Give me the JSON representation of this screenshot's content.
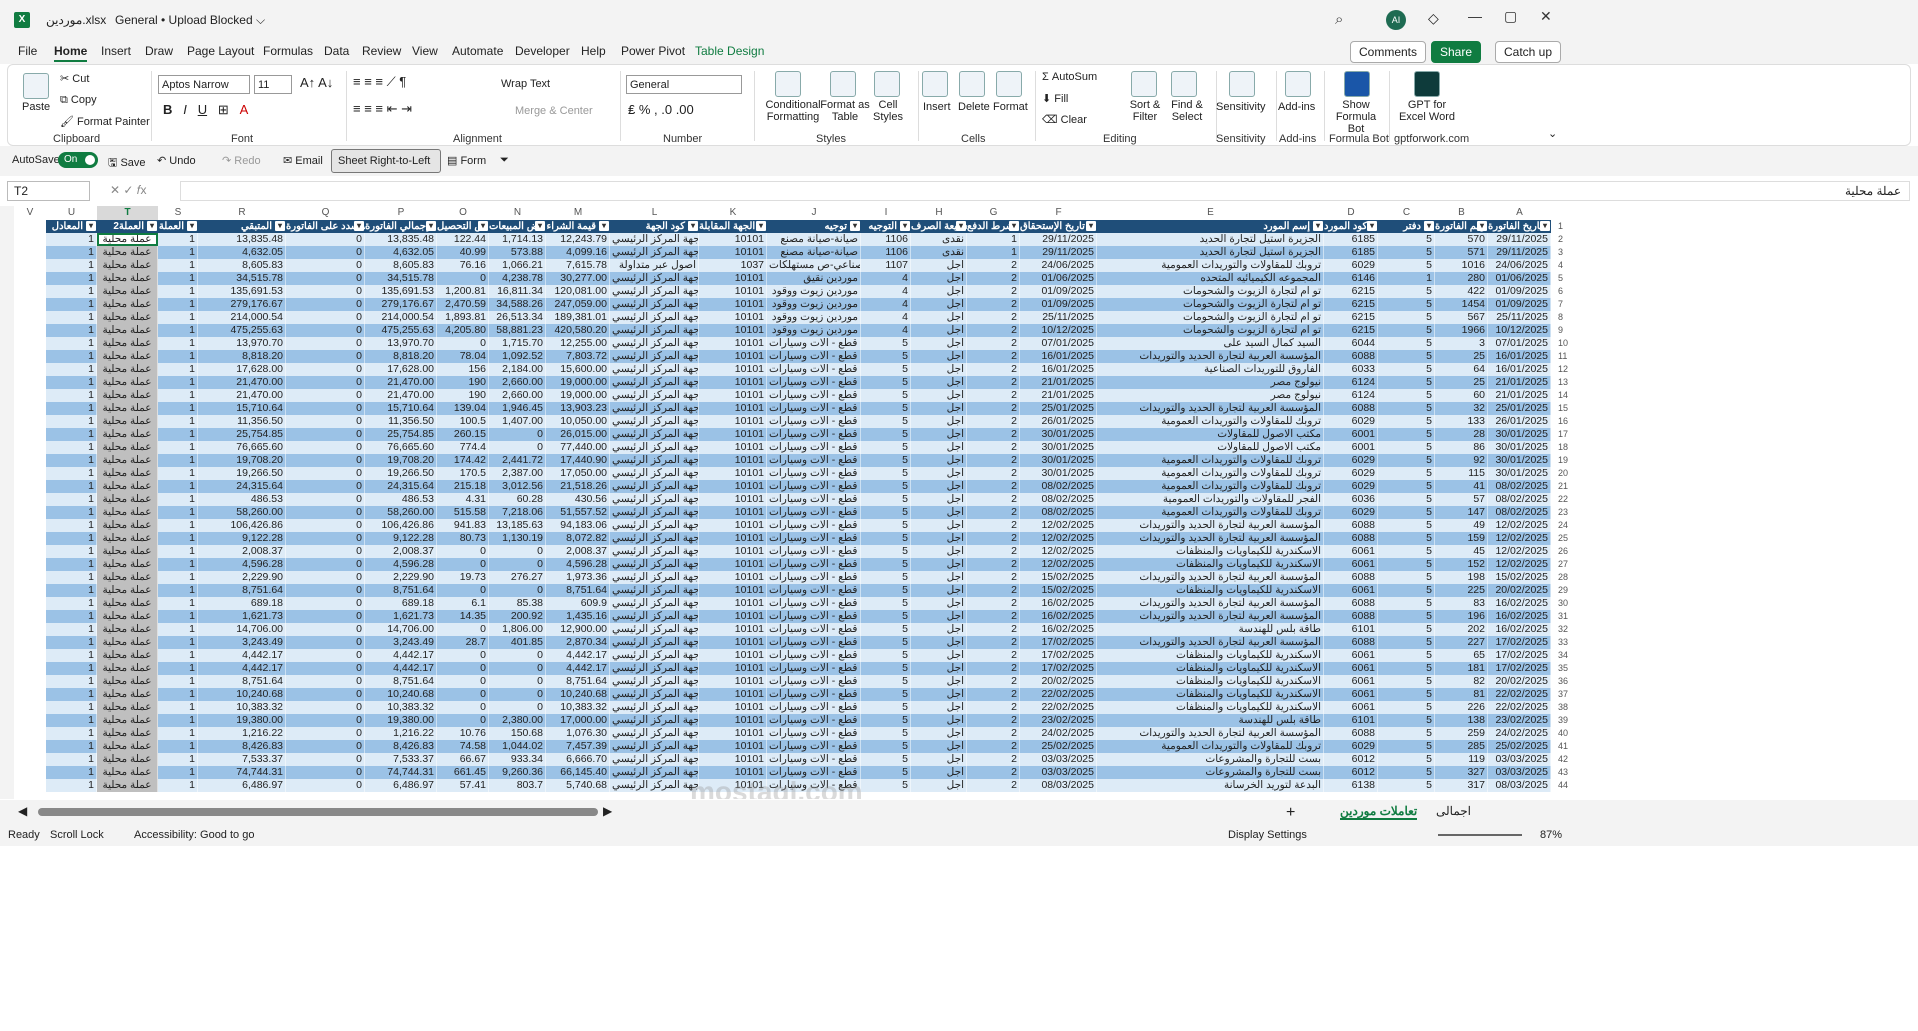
{
  "titlebar": {
    "file": "موردين.xlsx",
    "general": "General • Upload Blocked ⌵",
    "avatar": "AI",
    "minimize": "—",
    "maximize": "▢",
    "close": "✕"
  },
  "tabs": [
    "File",
    "Home",
    "Insert",
    "Draw",
    "Page Layout",
    "Formulas",
    "Data",
    "Review",
    "View",
    "Automate",
    "Developer",
    "Help",
    "Power Pivot",
    "Table Design"
  ],
  "header_btns": {
    "comments": "Comments",
    "share": "Share",
    "catchup": "Catch up"
  },
  "ribbon": {
    "clipboard": {
      "paste": "Paste",
      "cut": "Cut",
      "copy": "Copy",
      "format_painter": "Format Painter",
      "cap": "Clipboard"
    },
    "font": {
      "name": "Aptos Narrow",
      "size": "11",
      "cap": "Font"
    },
    "alignment": {
      "wrap": "Wrap Text",
      "merge": "Merge & Center",
      "cap": "Alignment"
    },
    "number": {
      "format": "General",
      "cap": "Number"
    },
    "styles": {
      "cond": "Conditional Formatting",
      "format_table": "Format as Table",
      "cell_styles": "Cell Styles",
      "cap": "Styles"
    },
    "cells": {
      "insert": "Insert",
      "delete": "Delete",
      "format": "Format",
      "cap": "Cells"
    },
    "editing": {
      "autosum": "AutoSum",
      "fill": "Fill",
      "clear": "Clear",
      "sort": "Sort & Filter",
      "find": "Find & Select",
      "cap": "Editing"
    },
    "sensitivity": {
      "label": "Sensitivity",
      "cap": "Sensitivity"
    },
    "addins": {
      "label": "Add-ins",
      "cap": "Add-ins"
    },
    "formulabot": {
      "label": "Show Formula Bot",
      "cap": "Formula Bot"
    },
    "gpt": {
      "label": "GPT for Excel Word",
      "cap": "gptforwork.com"
    }
  },
  "qat": {
    "autosave": "AutoSave",
    "on": "On",
    "save": "Save",
    "undo": "Undo",
    "redo": "Redo",
    "email": "Email",
    "srtl": "Sheet Right-to-Left",
    "form": "Form"
  },
  "namebox": "T2",
  "formula": "عملة محلية",
  "col_letters": [
    "A",
    "B",
    "C",
    "D",
    "E",
    "F",
    "G",
    "H",
    "I",
    "J",
    "K",
    "L",
    "M",
    "N",
    "O",
    "P",
    "Q",
    "R",
    "S",
    "T",
    "U",
    "V"
  ],
  "headers": [
    "تاريخ الفاتورة",
    "رقم الفاتورة",
    "دفتر",
    "كود المورد",
    "إسم المورد",
    "تاريخ الإستحقاق",
    "شرط الدفع",
    "طبيعة الصرف",
    "التوجيه",
    "توجيه",
    "الجهة المقابلة",
    "كود الجهة",
    "قيمة الشراء",
    "ض المبيعات",
    "ض التحصيل",
    "إجمالي الفاتورة",
    "المسدد على الفاتورة",
    "المتبقي",
    "العملة",
    "العملة2",
    "المعادل"
  ],
  "rows": [
    [
      "29/11/2025",
      "570",
      "5",
      "6185",
      "الجزيرة استيل لتجارة الحديد",
      "29/11/2025",
      "1",
      "نقدى",
      "1106",
      "صيانة-صيانة مصنع",
      "10101",
      "ك جهة المركز الرئيسي",
      "12,243.79",
      "1,714.13",
      "122.44",
      "13,835.48",
      "0",
      "13,835.48",
      "1",
      "عملة محلية",
      "1"
    ],
    [
      "29/11/2025",
      "571",
      "5",
      "6185",
      "الجزيرة استيل لتجارة الحديد",
      "29/11/2025",
      "1",
      "نقدى",
      "1106",
      "صيانة-صيانة مصنع",
      "10101",
      "ك جهة المركز الرئيسي",
      "4,099.16",
      "573.88",
      "40.99",
      "4,632.05",
      "0",
      "4,632.05",
      "1",
      "عملة محلية",
      "1"
    ],
    [
      "24/06/2025",
      "1016",
      "5",
      "6029",
      "تروبك للمقاولات والتوريدات العمومية",
      "24/06/2025",
      "2",
      "اجل",
      "1107",
      "امن صناعي-ص مستهلكات",
      "1037",
      "اصول عبر متداولة",
      "7,615.78",
      "1,066.21",
      "76.16",
      "8,605.83",
      "0",
      "8,605.83",
      "1",
      "عملة محلية",
      "1"
    ],
    [
      "01/06/2025",
      "280",
      "1",
      "6146",
      "المجموعه الكيميائيه المتحده",
      "01/06/2025",
      "2",
      "اجل",
      "4",
      "موردين نقيق",
      "10101",
      "ك جهة المركز الرئيسي",
      "30,277.00",
      "4,238.78",
      "0",
      "34,515.78",
      "0",
      "34,515.78",
      "1",
      "عملة محلية",
      "1"
    ],
    [
      "01/09/2025",
      "422",
      "5",
      "6215",
      "تو ام لتجارة الزيوت والشحومات",
      "01/09/2025",
      "2",
      "اجل",
      "4",
      "موردين زيوت ووقود",
      "10101",
      "ك جهة المركز الرئيسي",
      "120,081.00",
      "16,811.34",
      "1,200.81",
      "135,691.53",
      "0",
      "135,691.53",
      "1",
      "عملة محلية",
      "1"
    ],
    [
      "01/09/2025",
      "1454",
      "5",
      "6215",
      "تو ام لتجارة الزيوت والشحومات",
      "01/09/2025",
      "2",
      "اجل",
      "4",
      "موردين زيوت ووقود",
      "10101",
      "ك جهة المركز الرئيسي",
      "247,059.00",
      "34,588.26",
      "2,470.59",
      "279,176.67",
      "0",
      "279,176.67",
      "1",
      "عملة محلية",
      "1"
    ],
    [
      "25/11/2025",
      "567",
      "5",
      "6215",
      "تو ام لتجارة الزيوت والشحومات",
      "25/11/2025",
      "2",
      "اجل",
      "4",
      "موردين زيوت ووقود",
      "10101",
      "ك جهة المركز الرئيسي",
      "189,381.01",
      "26,513.34",
      "1,893.81",
      "214,000.54",
      "0",
      "214,000.54",
      "1",
      "عملة محلية",
      "1"
    ],
    [
      "10/12/2025",
      "1966",
      "5",
      "6215",
      "تو ام لتجارة الزيوت والشحومات",
      "10/12/2025",
      "2",
      "اجل",
      "4",
      "موردين زيوت ووقود",
      "10101",
      "ك جهة المركز الرئيسي",
      "420,580.20",
      "58,881.23",
      "4,205.80",
      "475,255.63",
      "0",
      "475,255.63",
      "1",
      "عملة محلية",
      "1"
    ],
    [
      "07/01/2025",
      "3",
      "5",
      "6044",
      "السيد كمال السيد على",
      "07/01/2025",
      "2",
      "اجل",
      "5",
      "م قطع - الات وسيارات",
      "10101",
      "ك جهة المركز الرئيسي",
      "12,255.00",
      "1,715.70",
      "0",
      "13,970.70",
      "0",
      "13,970.70",
      "1",
      "عملة محلية",
      "1"
    ],
    [
      "16/01/2025",
      "25",
      "5",
      "6088",
      "المؤسسة العربية لتجارة الحديد والتوريدات",
      "16/01/2025",
      "2",
      "اجل",
      "5",
      "م قطع - الات وسيارات",
      "10101",
      "ك جهة المركز الرئيسي",
      "7,803.72",
      "1,092.52",
      "78.04",
      "8,818.20",
      "0",
      "8,818.20",
      "1",
      "عملة محلية",
      "1"
    ],
    [
      "16/01/2025",
      "64",
      "5",
      "6033",
      "الفاروق للتوريدات الصناعية",
      "16/01/2025",
      "2",
      "اجل",
      "5",
      "م قطع - الات وسيارات",
      "10101",
      "ك جهة المركز الرئيسي",
      "15,600.00",
      "2,184.00",
      "156",
      "17,628.00",
      "0",
      "17,628.00",
      "1",
      "عملة محلية",
      "1"
    ],
    [
      "21/01/2025",
      "25",
      "5",
      "6124",
      "نيولوج مصر",
      "21/01/2025",
      "2",
      "اجل",
      "5",
      "م قطع - الات وسيارات",
      "10101",
      "ك جهة المركز الرئيسي",
      "19,000.00",
      "2,660.00",
      "190",
      "21,470.00",
      "0",
      "21,470.00",
      "1",
      "عملة محلية",
      "1"
    ],
    [
      "21/01/2025",
      "60",
      "5",
      "6124",
      "نيولوج مصر",
      "21/01/2025",
      "2",
      "اجل",
      "5",
      "م قطع - الات وسيارات",
      "10101",
      "ك جهة المركز الرئيسي",
      "19,000.00",
      "2,660.00",
      "190",
      "21,470.00",
      "0",
      "21,470.00",
      "1",
      "عملة محلية",
      "1"
    ],
    [
      "25/01/2025",
      "32",
      "5",
      "6088",
      "المؤسسة العربية لتجارة الحديد والتوريدات",
      "25/01/2025",
      "2",
      "اجل",
      "5",
      "م قطع - الات وسيارات",
      "10101",
      "ك جهة المركز الرئيسي",
      "13,903.23",
      "1,946.45",
      "139.04",
      "15,710.64",
      "0",
      "15,710.64",
      "1",
      "عملة محلية",
      "1"
    ],
    [
      "26/01/2025",
      "133",
      "5",
      "6029",
      "تروبك للمقاولات والتوريدات العمومية",
      "26/01/2025",
      "2",
      "اجل",
      "5",
      "م قطع - الات وسيارات",
      "10101",
      "ك جهة المركز الرئيسي",
      "10,050.00",
      "1,407.00",
      "100.5",
      "11,356.50",
      "0",
      "11,356.50",
      "1",
      "عملة محلية",
      "1"
    ],
    [
      "30/01/2025",
      "28",
      "5",
      "6001",
      "مكتب الاصول للمقاولات",
      "30/01/2025",
      "2",
      "اجل",
      "5",
      "م قطع - الات وسيارات",
      "10101",
      "ك جهة المركز الرئيسي",
      "26,015.00",
      "0",
      "260.15",
      "25,754.85",
      "0",
      "25,754.85",
      "1",
      "عملة محلية",
      "1"
    ],
    [
      "30/01/2025",
      "86",
      "5",
      "6001",
      "مكتب الاصول للمقاولات",
      "30/01/2025",
      "2",
      "اجل",
      "5",
      "م قطع - الات وسيارات",
      "10101",
      "ك جهة المركز الرئيسي",
      "77,440.00",
      "0",
      "774.4",
      "76,665.60",
      "0",
      "76,665.60",
      "1",
      "عملة محلية",
      "1"
    ],
    [
      "30/01/2025",
      "92",
      "5",
      "6029",
      "تروبك للمقاولات والتوريدات العمومية",
      "30/01/2025",
      "2",
      "اجل",
      "5",
      "م قطع - الات وسيارات",
      "10101",
      "ك جهة المركز الرئيسي",
      "17,440.90",
      "2,441.72",
      "174.42",
      "19,708.20",
      "0",
      "19,708.20",
      "1",
      "عملة محلية",
      "1"
    ],
    [
      "30/01/2025",
      "115",
      "5",
      "6029",
      "تروبك للمقاولات والتوريدات العمومية",
      "30/01/2025",
      "2",
      "اجل",
      "5",
      "م قطع - الات وسيارات",
      "10101",
      "ك جهة المركز الرئيسي",
      "17,050.00",
      "2,387.00",
      "170.5",
      "19,266.50",
      "0",
      "19,266.50",
      "1",
      "عملة محلية",
      "1"
    ],
    [
      "08/02/2025",
      "41",
      "5",
      "6029",
      "تروبك للمقاولات والتوريدات العمومية",
      "08/02/2025",
      "2",
      "اجل",
      "5",
      "م قطع - الات وسيارات",
      "10101",
      "ك جهة المركز الرئيسي",
      "21,518.26",
      "3,012.56",
      "215.18",
      "24,315.64",
      "0",
      "24,315.64",
      "1",
      "عملة محلية",
      "1"
    ],
    [
      "08/02/2025",
      "57",
      "5",
      "6036",
      "الفجر للمقاولات والتوريدات العمومية",
      "08/02/2025",
      "2",
      "اجل",
      "5",
      "م قطع - الات وسيارات",
      "10101",
      "ك جهة المركز الرئيسي",
      "430.56",
      "60.28",
      "4.31",
      "486.53",
      "0",
      "486.53",
      "1",
      "عملة محلية",
      "1"
    ],
    [
      "08/02/2025",
      "147",
      "5",
      "6029",
      "تروبك للمقاولات والتوريدات العمومية",
      "08/02/2025",
      "2",
      "اجل",
      "5",
      "م قطع - الات وسيارات",
      "10101",
      "ك جهة المركز الرئيسي",
      "51,557.52",
      "7,218.06",
      "515.58",
      "58,260.00",
      "0",
      "58,260.00",
      "1",
      "عملة محلية",
      "1"
    ],
    [
      "12/02/2025",
      "49",
      "5",
      "6088",
      "المؤسسة العربية لتجارة الحديد والتوريدات",
      "12/02/2025",
      "2",
      "اجل",
      "5",
      "م قطع - الات وسيارات",
      "10101",
      "ك جهة المركز الرئيسي",
      "94,183.06",
      "13,185.63",
      "941.83",
      "106,426.86",
      "0",
      "106,426.86",
      "1",
      "عملة محلية",
      "1"
    ],
    [
      "12/02/2025",
      "159",
      "5",
      "6088",
      "المؤسسة العربية لتجارة الحديد والتوريدات",
      "12/02/2025",
      "2",
      "اجل",
      "5",
      "م قطع - الات وسيارات",
      "10101",
      "ك جهة المركز الرئيسي",
      "8,072.82",
      "1,130.19",
      "80.73",
      "9,122.28",
      "0",
      "9,122.28",
      "1",
      "عملة محلية",
      "1"
    ],
    [
      "12/02/2025",
      "45",
      "5",
      "6061",
      "الاسكندرية للكيماويات والمنظفات",
      "12/02/2025",
      "2",
      "اجل",
      "5",
      "م قطع - الات وسيارات",
      "10101",
      "ك جهة المركز الرئيسي",
      "2,008.37",
      "0",
      "0",
      "2,008.37",
      "0",
      "2,008.37",
      "1",
      "عملة محلية",
      "1"
    ],
    [
      "12/02/2025",
      "152",
      "5",
      "6061",
      "الاسكندرية للكيماويات والمنظفات",
      "12/02/2025",
      "2",
      "اجل",
      "5",
      "م قطع - الات وسيارات",
      "10101",
      "ك جهة المركز الرئيسي",
      "4,596.28",
      "0",
      "0",
      "4,596.28",
      "0",
      "4,596.28",
      "1",
      "عملة محلية",
      "1"
    ],
    [
      "15/02/2025",
      "198",
      "5",
      "6088",
      "المؤسسة العربية لتجارة الحديد والتوريدات",
      "15/02/2025",
      "2",
      "اجل",
      "5",
      "م قطع - الات وسيارات",
      "10101",
      "ك جهة المركز الرئيسي",
      "1,973.36",
      "276.27",
      "19.73",
      "2,229.90",
      "0",
      "2,229.90",
      "1",
      "عملة محلية",
      "1"
    ],
    [
      "20/02/2025",
      "225",
      "5",
      "6061",
      "الاسكندرية للكيماويات والمنظفات",
      "15/02/2025",
      "2",
      "اجل",
      "5",
      "م قطع - الات وسيارات",
      "10101",
      "ك جهة المركز الرئيسي",
      "8,751.64",
      "0",
      "0",
      "8,751.64",
      "0",
      "8,751.64",
      "1",
      "عملة محلية",
      "1"
    ],
    [
      "16/02/2025",
      "83",
      "5",
      "6088",
      "المؤسسة العربية لتجارة الحديد والتوريدات",
      "16/02/2025",
      "2",
      "اجل",
      "5",
      "م قطع - الات وسيارات",
      "10101",
      "ك جهة المركز الرئيسي",
      "609.9",
      "85.38",
      "6.1",
      "689.18",
      "0",
      "689.18",
      "1",
      "عملة محلية",
      "1"
    ],
    [
      "16/02/2025",
      "196",
      "5",
      "6088",
      "المؤسسة العربية لتجارة الحديد والتوريدات",
      "16/02/2025",
      "2",
      "اجل",
      "5",
      "م قطع - الات وسيارات",
      "10101",
      "ك جهة المركز الرئيسي",
      "1,435.16",
      "200.92",
      "14.35",
      "1,621.73",
      "0",
      "1,621.73",
      "1",
      "عملة محلية",
      "1"
    ],
    [
      "16/02/2025",
      "202",
      "5",
      "6101",
      "طاقة بلس للهندسة",
      "16/02/2025",
      "2",
      "اجل",
      "5",
      "م قطع - الات وسيارات",
      "10101",
      "ك جهة المركز الرئيسي",
      "12,900.00",
      "1,806.00",
      "0",
      "14,706.00",
      "0",
      "14,706.00",
      "1",
      "عملة محلية",
      "1"
    ],
    [
      "17/02/2025",
      "227",
      "5",
      "6088",
      "المؤسسة العربية لتجارة الحديد والتوريدات",
      "17/02/2025",
      "2",
      "اجل",
      "5",
      "م قطع - الات وسيارات",
      "10101",
      "ك جهة المركز الرئيسي",
      "2,870.34",
      "401.85",
      "28.7",
      "3,243.49",
      "0",
      "3,243.49",
      "1",
      "عملة محلية",
      "1"
    ],
    [
      "17/02/2025",
      "65",
      "5",
      "6061",
      "الاسكندرية للكيماويات والمنظفات",
      "17/02/2025",
      "2",
      "اجل",
      "5",
      "م قطع - الات وسيارات",
      "10101",
      "ك جهة المركز الرئيسي",
      "4,442.17",
      "0",
      "0",
      "4,442.17",
      "0",
      "4,442.17",
      "1",
      "عملة محلية",
      "1"
    ],
    [
      "17/02/2025",
      "181",
      "5",
      "6061",
      "الاسكندرية للكيماويات والمنظفات",
      "17/02/2025",
      "2",
      "اجل",
      "5",
      "م قطع - الات وسيارات",
      "10101",
      "ك جهة المركز الرئيسي",
      "4,442.17",
      "0",
      "0",
      "4,442.17",
      "0",
      "4,442.17",
      "1",
      "عملة محلية",
      "1"
    ],
    [
      "20/02/2025",
      "82",
      "5",
      "6061",
      "الاسكندرية للكيماويات والمنظفات",
      "20/02/2025",
      "2",
      "اجل",
      "5",
      "م قطع - الات وسيارات",
      "10101",
      "ك جهة المركز الرئيسي",
      "8,751.64",
      "0",
      "0",
      "8,751.64",
      "0",
      "8,751.64",
      "1",
      "عملة محلية",
      "1"
    ],
    [
      "22/02/2025",
      "81",
      "5",
      "6061",
      "الاسكندرية للكيماويات والمنظفات",
      "22/02/2025",
      "2",
      "اجل",
      "5",
      "م قطع - الات وسيارات",
      "10101",
      "ك جهة المركز الرئيسي",
      "10,240.68",
      "0",
      "0",
      "10,240.68",
      "0",
      "10,240.68",
      "1",
      "عملة محلية",
      "1"
    ],
    [
      "22/02/2025",
      "226",
      "5",
      "6061",
      "الاسكندرية للكيماويات والمنظفات",
      "22/02/2025",
      "2",
      "اجل",
      "5",
      "م قطع - الات وسيارات",
      "10101",
      "ك جهة المركز الرئيسي",
      "10,383.32",
      "0",
      "0",
      "10,383.32",
      "0",
      "10,383.32",
      "1",
      "عملة محلية",
      "1"
    ],
    [
      "23/02/2025",
      "138",
      "5",
      "6101",
      "طاقة بلس للهندسة",
      "23/02/2025",
      "2",
      "اجل",
      "5",
      "م قطع - الات وسيارات",
      "10101",
      "ك جهة المركز الرئيسي",
      "17,000.00",
      "2,380.00",
      "0",
      "19,380.00",
      "0",
      "19,380.00",
      "1",
      "عملة محلية",
      "1"
    ],
    [
      "24/02/2025",
      "259",
      "5",
      "6088",
      "المؤسسة العربية لتجارة الحديد والتوريدات",
      "24/02/2025",
      "2",
      "اجل",
      "5",
      "م قطع - الات وسيارات",
      "10101",
      "ك جهة المركز الرئيسي",
      "1,076.30",
      "150.68",
      "10.76",
      "1,216.22",
      "0",
      "1,216.22",
      "1",
      "عملة محلية",
      "1"
    ],
    [
      "25/02/2025",
      "285",
      "5",
      "6029",
      "تروبك للمقاولات والتوريدات العمومية",
      "25/02/2025",
      "2",
      "اجل",
      "5",
      "م قطع - الات وسيارات",
      "10101",
      "ك جهة المركز الرئيسي",
      "7,457.39",
      "1,044.02",
      "74.58",
      "8,426.83",
      "0",
      "8,426.83",
      "1",
      "عملة محلية",
      "1"
    ],
    [
      "03/03/2025",
      "119",
      "5",
      "6012",
      "بست للتجارة والمشروعات",
      "03/03/2025",
      "2",
      "اجل",
      "5",
      "م قطع - الات وسيارات",
      "10101",
      "ك جهة المركز الرئيسي",
      "6,666.70",
      "933.34",
      "66.67",
      "7,533.37",
      "0",
      "7,533.37",
      "1",
      "عملة محلية",
      "1"
    ],
    [
      "03/03/2025",
      "327",
      "5",
      "6012",
      "بست للتجارة والمشروعات",
      "03/03/2025",
      "2",
      "اجل",
      "5",
      "م قطع - الات وسيارات",
      "10101",
      "ك جهة المركز الرئيسي",
      "66,145.40",
      "9,260.36",
      "661.45",
      "74,744.31",
      "0",
      "74,744.31",
      "1",
      "عملة محلية",
      "1"
    ],
    [
      "08/03/2025",
      "317",
      "5",
      "6138",
      "البدعة لتوريد الخرسانة",
      "08/03/2025",
      "2",
      "اجل",
      "5",
      "م قطع - الات وسيارات",
      "10101",
      "ك جهة المركز الرئيسي",
      "5,740.68",
      "803.7",
      "57.41",
      "6,486.97",
      "0",
      "6,486.97",
      "1",
      "عملة محلية",
      "1"
    ]
  ],
  "sheets": {
    "active": "تعاملات موردين",
    "other": "اجمالى",
    "add": "+"
  },
  "status": {
    "ready": "Ready",
    "scroll": "Scroll Lock",
    "access": "Accessibility: Good to go",
    "display": "Display Settings",
    "zoom": "87%"
  },
  "watermark": "mostaql.com",
  "colors": {
    "header": "#1f4e79",
    "band_light": "#ddebf7",
    "band_dark": "#9bc2e6",
    "selected": "#bfbfbf",
    "accent": "#107c41"
  }
}
